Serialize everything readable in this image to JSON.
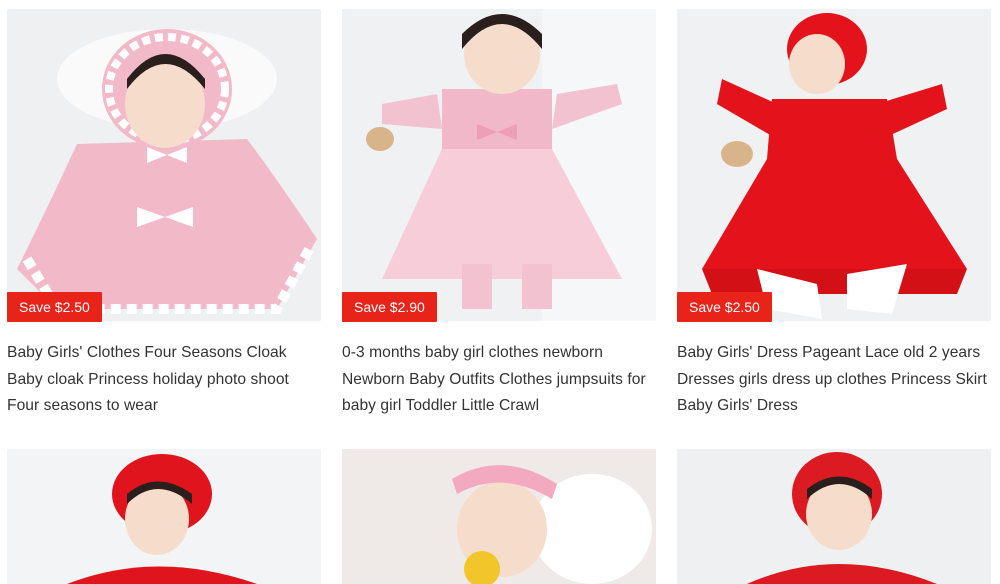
{
  "theme": {
    "badge_color": "#e8231a",
    "text_color": "#333333"
  },
  "products": [
    {
      "title": "Baby Girls' Clothes Four Seasons Cloak Baby cloak Princess holiday photo shoot Four seasons to wear",
      "badge": "Save $2.50",
      "garment_color": "#f0b7c6",
      "image_icon": "baby-pink-cloak-photo"
    },
    {
      "title": "0-3 months baby girl clothes newborn Newborn Baby Outfits Clothes jumpsuits for baby girl Toddler Little Crawl",
      "badge": "Save $2.90",
      "garment_color": "#f5c6d4",
      "image_icon": "baby-pink-tulle-dress-photo"
    },
    {
      "title": "Baby Girls' Dress Pageant Lace old 2 years Dresses girls dress up clothes Princess Skirt Baby Girls' Dress",
      "badge": "Save $2.50",
      "garment_color": "#e3121b",
      "image_icon": "baby-red-lace-dress-photo"
    },
    {
      "image_icon": "baby-red-bonnet-photo",
      "garment_color": "#e0141c"
    },
    {
      "image_icon": "baby-flower-headband-photo",
      "garment_color": "#f3a9c0"
    },
    {
      "image_icon": "baby-red-hood-photo",
      "garment_color": "#dc1a22"
    }
  ]
}
